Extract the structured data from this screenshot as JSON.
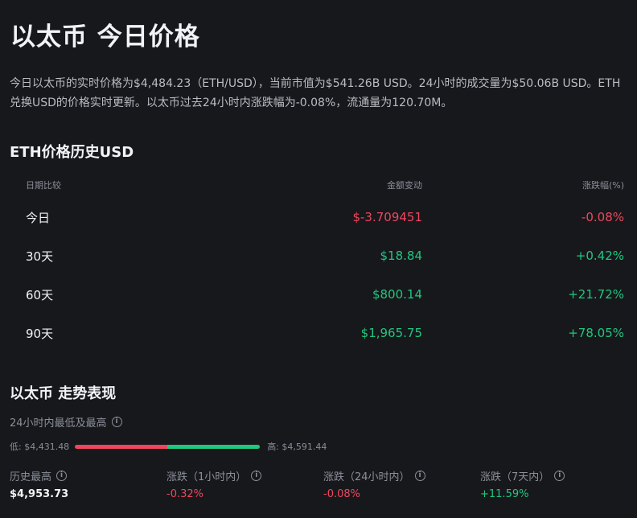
{
  "title": "以太币 今日价格",
  "description": "今日以太币的实时价格为$4,484.23（ETH/USD），当前市值为$541.26B USD。24小时的成交量为$50.06B USD。ETH兑换USD的价格实时更新。以太币过去24小时内涨跌幅为-0.08%，流通量为120.70M。",
  "history": {
    "heading": "ETH价格历史USD",
    "columns": [
      "日期比较",
      "金额变动",
      "涨跌幅(%)"
    ],
    "rows": [
      {
        "period": "今日",
        "change": "$-3.709451",
        "pct": "-0.08%",
        "trend": "neg"
      },
      {
        "period": "30天",
        "change": "$18.84",
        "pct": "+0.42%",
        "trend": "pos"
      },
      {
        "period": "60天",
        "change": "$800.14",
        "pct": "+21.72%",
        "trend": "pos"
      },
      {
        "period": "90天",
        "change": "$1,965.75",
        "pct": "+78.05%",
        "trend": "pos"
      }
    ]
  },
  "performance": {
    "heading": "以太币 走势表现",
    "range_label": "24小时内最低及最高",
    "low": "低: $4,431.48",
    "high": "高: $4,591.44",
    "range_position": 0.5,
    "stats": [
      {
        "label": "历史最高",
        "value": "$4,953.73",
        "trend": "white"
      },
      {
        "label": "涨跌（1小时内）",
        "value": "-0.32%",
        "trend": "neg"
      },
      {
        "label": "涨跌（24小时内）",
        "value": "-0.08%",
        "trend": "neg"
      },
      {
        "label": "涨跌（7天内）",
        "value": "+11.59%",
        "trend": "pos"
      }
    ]
  },
  "colors": {
    "negative": "#f0465d",
    "positive": "#20c77e",
    "background": "#17181c"
  },
  "icons": {
    "info": "info-circle-icon"
  }
}
